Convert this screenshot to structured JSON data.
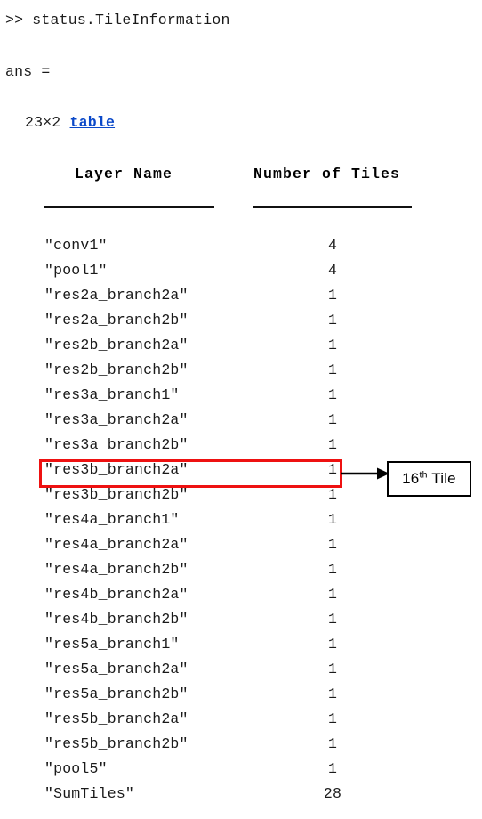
{
  "console": {
    "prompt": ">> status.TileInformation",
    "ans_label": "ans =",
    "size_dims": "23×2",
    "type_link": "table"
  },
  "table": {
    "headers": {
      "layer_name": "Layer Name",
      "number_of_tiles": "Number of Tiles"
    },
    "rows": [
      {
        "name": "\"conv1\"",
        "count": "4"
      },
      {
        "name": "\"pool1\"",
        "count": "4"
      },
      {
        "name": "\"res2a_branch2a\"",
        "count": "1"
      },
      {
        "name": "\"res2a_branch2b\"",
        "count": "1"
      },
      {
        "name": "\"res2b_branch2a\"",
        "count": "1"
      },
      {
        "name": "\"res2b_branch2b\"",
        "count": "1"
      },
      {
        "name": "\"res3a_branch1\"",
        "count": "1"
      },
      {
        "name": "\"res3a_branch2a\"",
        "count": "1"
      },
      {
        "name": "\"res3a_branch2b\"",
        "count": "1"
      },
      {
        "name": "\"res3b_branch2a\"",
        "count": "1"
      },
      {
        "name": "\"res3b_branch2b\"",
        "count": "1"
      },
      {
        "name": "\"res4a_branch1\"",
        "count": "1"
      },
      {
        "name": "\"res4a_branch2a\"",
        "count": "1"
      },
      {
        "name": "\"res4a_branch2b\"",
        "count": "1"
      },
      {
        "name": "\"res4b_branch2a\"",
        "count": "1"
      },
      {
        "name": "\"res4b_branch2b\"",
        "count": "1"
      },
      {
        "name": "\"res5a_branch1\"",
        "count": "1"
      },
      {
        "name": "\"res5a_branch2a\"",
        "count": "1"
      },
      {
        "name": "\"res5a_branch2b\"",
        "count": "1"
      },
      {
        "name": "\"res5b_branch2a\"",
        "count": "1"
      },
      {
        "name": "\"res5b_branch2b\"",
        "count": "1"
      },
      {
        "name": "\"pool5\"",
        "count": "1"
      },
      {
        "name": "\"SumTiles\"",
        "count": "28"
      }
    ]
  },
  "annotation": {
    "highlighted_row_index": 9,
    "highlighted_row_name": "\"res3b_branch2a\"",
    "callout_number": "16",
    "callout_ordinal_suffix": "th",
    "callout_word": "Tile",
    "highlight_color": "#ee1111",
    "arrow_color": "#000000",
    "link_color": "#0b49c9"
  }
}
